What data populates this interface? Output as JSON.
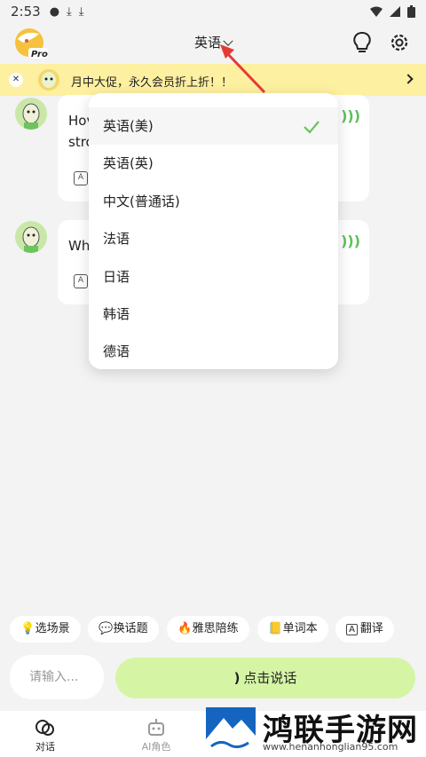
{
  "status_bar": {
    "time": "2:53"
  },
  "header": {
    "language": "英语"
  },
  "promo": {
    "text": "月中大促，永久会员折上折！！"
  },
  "messages": [
    {
      "text_line1": "Hov",
      "text_line2": "stro"
    },
    {
      "text_line1": "Wh"
    }
  ],
  "dropdown": {
    "items": [
      "英语(美)",
      "英语(英)",
      "中文(普通话)",
      "法语",
      "日语",
      "韩语",
      "德语"
    ],
    "selected": "英语(美)"
  },
  "chips": [
    "💡选场景",
    "💬换话题",
    "🔥雅思陪练",
    "📒单词本",
    "翻译"
  ],
  "input": {
    "placeholder": "请输入..."
  },
  "talk_button": {
    "label": "点击说话"
  },
  "tabs": [
    {
      "label": "对话",
      "icon": "chat-icon"
    },
    {
      "label": "AI角色",
      "icon": "robot-icon"
    }
  ],
  "watermark": {
    "title": "鸿联手游网",
    "url": "www.henanhonglian95.com"
  },
  "colors": {
    "accent_green": "#d5f5a5",
    "promo_yellow": "#fdf0a0",
    "check_green": "#6cc35f",
    "arrow_red": "#e53935"
  }
}
